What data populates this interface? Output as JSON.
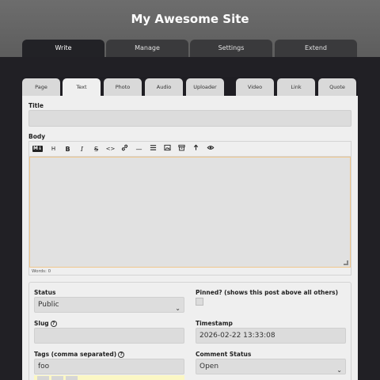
{
  "header": {
    "site_title": "My Awesome Site"
  },
  "main_tabs": [
    {
      "label": "Write",
      "active": true
    },
    {
      "label": "Manage"
    },
    {
      "label": "Settings"
    },
    {
      "label": "Extend"
    }
  ],
  "sub_tabs": [
    {
      "label": "Page"
    },
    {
      "label": "Text",
      "active": true
    },
    {
      "label": "Photo"
    },
    {
      "label": "Audio"
    },
    {
      "label": "Uploader"
    },
    {
      "label": "Video"
    },
    {
      "label": "Link"
    },
    {
      "label": "Quote"
    }
  ],
  "form": {
    "title_label": "Title",
    "title_value": "",
    "body_label": "Body",
    "body_value": "",
    "word_count": "Words: 0",
    "toolbar": {
      "markdown_badge": "M↓",
      "icons": [
        "heading-icon",
        "bold-icon",
        "italic-icon",
        "strikethrough-icon",
        "code-icon",
        "link-icon",
        "horizontal-rule-icon",
        "list-icon",
        "image-icon",
        "archive-icon",
        "upload-icon",
        "preview-icon"
      ]
    },
    "status_label": "Status",
    "status_value": "Public",
    "pinned_label": "Pinned? (shows this post above all others)",
    "slug_label": "Slug",
    "slug_value": "",
    "timestamp_label": "Timestamp",
    "timestamp_value": "2026-02-22 13:33:08",
    "tags_label": "Tags (comma separated)",
    "tags_value": "foo",
    "comment_status_label": "Comment Status",
    "comment_status_value": "Open"
  },
  "colors": {
    "header_bg": "#666666",
    "page_bg": "#212025",
    "panel_bg": "#efefef",
    "active_field_border": "#f0c78c"
  }
}
